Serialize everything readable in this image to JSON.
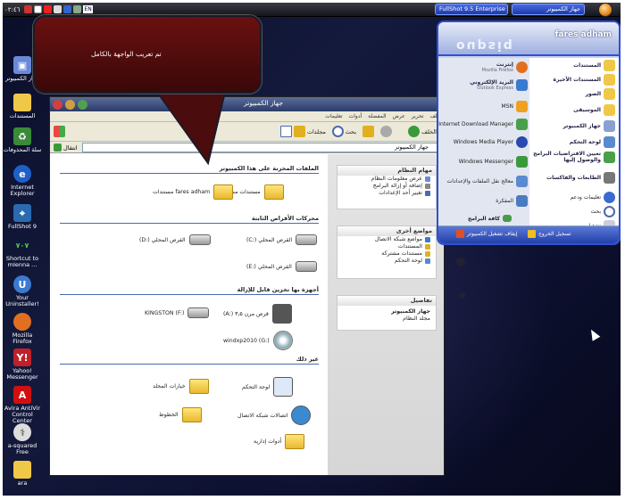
{
  "taskbar": {
    "clock": "٠٢:٤٦",
    "lang": "EN",
    "tasks": [
      "FullShot 9.5 Enterprise",
      "جهاز الكمبيوتر"
    ]
  },
  "desktop_icons": [
    {
      "label": "جهاز الكمبيوتر",
      "icon": "computer-icon"
    },
    {
      "label": "المستندات",
      "icon": "documents-icon"
    },
    {
      "label": "سلة المحذوفات",
      "icon": "recycle-bin-icon"
    },
    {
      "label": "Internet Explorer",
      "icon": "ie-icon"
    },
    {
      "label": "FullShot 9",
      "icon": "fullshot-icon"
    },
    {
      "label": "Shortcut to mIenna ...",
      "icon": "shortcut-icon",
      "badge": "٧٠٧"
    },
    {
      "label": "Your Uninstaller!",
      "icon": "uninstaller-icon"
    },
    {
      "label": "Mozilla Firefox",
      "icon": "firefox-icon"
    },
    {
      "label": "Yahoo! Messenger",
      "icon": "yahoo-icon"
    },
    {
      "label": "Avira AntiVir Control Center",
      "icon": "avira-icon"
    },
    {
      "label": "a-squared Free",
      "icon": "asquared-icon"
    },
    {
      "label": "ara",
      "icon": "folder-icon"
    }
  ],
  "callout": {
    "text": "تم تعريب  الواجهة  بالكامل"
  },
  "window": {
    "title": "جهاز الكمبيوتر",
    "menu": [
      "ملف",
      "تحرير",
      "عرض",
      "المفضلة",
      "أدوات",
      "تعليمات"
    ],
    "toolbar": {
      "back": "الخلف",
      "search": "بحث",
      "folders": "مجلدات"
    },
    "address": "جهاز الكمبيوتر",
    "go": "انتقال",
    "tasks_system": {
      "title": "مهام النظام",
      "items": [
        "عرض معلومات النظام",
        "إضافة أو إزالة البرامج",
        "تغيير أحد الإعدادات"
      ]
    },
    "tasks_other": {
      "title": "مواضع أخرى",
      "items": [
        "مواضع شبكة الاتصال",
        "المستندات",
        "مستندات مشتركة",
        "لوحة التحكم"
      ]
    },
    "details": {
      "title": "تفاصيل",
      "name": "جهاز الكمبيوتر",
      "sub": "مجلد النظام"
    },
    "groups": {
      "stored": "الملفات المخزنة على هذا الكمبيوتر",
      "hdd": "محركات الأقراص الثابتة",
      "removable": "أجهزة بها تخزين قابل للإزالة",
      "other": "غير ذلك"
    },
    "items": {
      "shared_docs": "مستندات مشتركة",
      "user_docs": "fares adham مستندات",
      "c_drive": "القرص المحلي (:C)",
      "d_drive": "القرص المحلي (:D)",
      "e_drive": "القرص المحلي (:E)",
      "floppy": "قرص مرن ٣٫٥ (:A)",
      "kingston": "KINGSTON (F:)",
      "dvd": "windxp2010 (G:)",
      "control_panel": "لوحة التحكم",
      "folder_options": "خيارات المجلد",
      "network": "اتصالات شبكة الاتصال",
      "fonts": "الخطوط",
      "admin_tools": "أدوات إدارية"
    }
  },
  "start_menu": {
    "user": "fares adham",
    "brand": "oupsiq",
    "right": [
      {
        "label": "إنترنت",
        "sub": "Mozilla Firefox"
      },
      {
        "label": "البريد الإلكتروني",
        "sub": "Outlook Express"
      },
      {
        "label": "MSN"
      },
      {
        "label": "Internet Download Manager"
      },
      {
        "label": "Windows Media Player"
      },
      {
        "label": "Windows Messenger"
      },
      {
        "label": "معالج نقل الملفات والإعدادات"
      },
      {
        "label": "المفكرة"
      }
    ],
    "all_programs": "كافة البرامج",
    "left": [
      {
        "label": "المستندات"
      },
      {
        "label": "المستندات الأخيرة"
      },
      {
        "label": "الصور"
      },
      {
        "label": "الموسيقى"
      },
      {
        "label": "جهاز الكمبيوتر"
      },
      {
        "label": "لوحة التحكم"
      },
      {
        "label": "تعيين الافتراضيات البرامج والوصول إليها"
      },
      {
        "label": "الطابعات والفاكسات"
      },
      {
        "label": "تعليمات ودعم"
      },
      {
        "label": "بحث"
      },
      {
        "label": "تشغيل..."
      }
    ],
    "logoff": "تسجيل الخروج",
    "shutdown": "إيقاف تشغيل الكمبيوتر"
  }
}
